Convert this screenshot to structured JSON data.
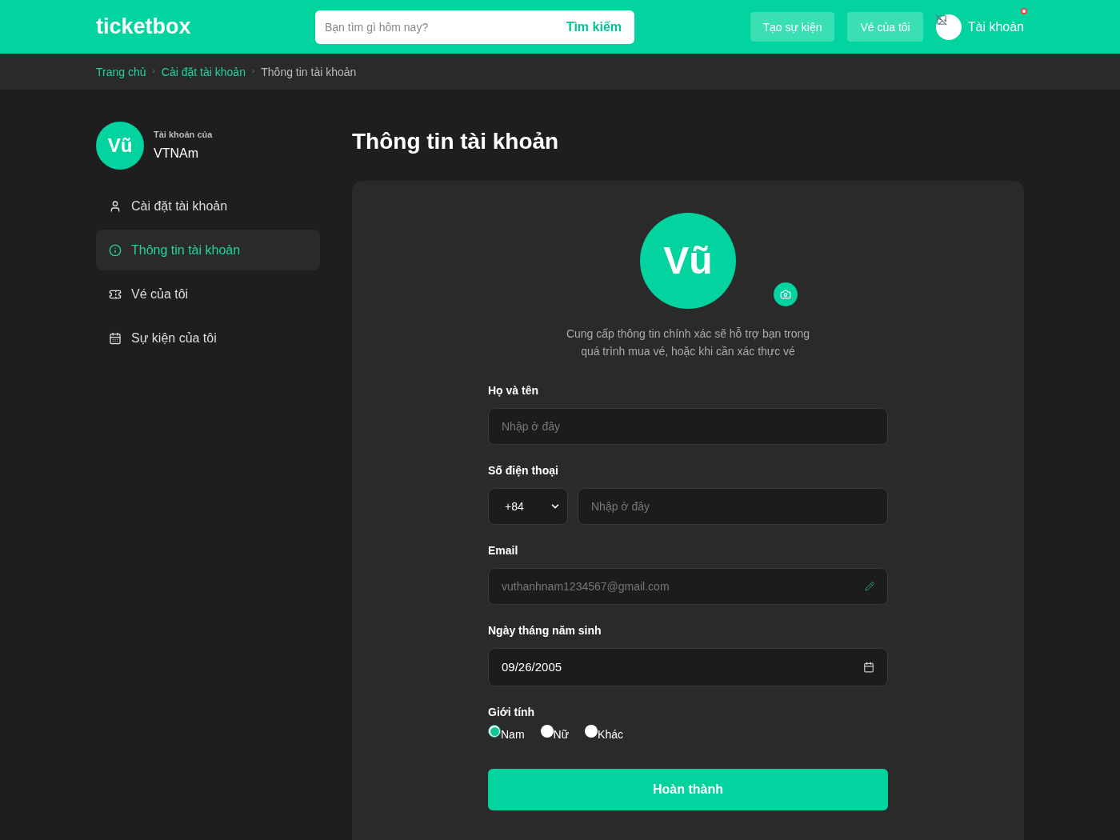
{
  "header": {
    "logo": "ticketbox",
    "search": {
      "placeholder": "Bạn tìm gì hôm nay?",
      "button": "Tìm kiếm"
    },
    "buttons": [
      "Tạo sự kiện",
      "Vé của tôi"
    ],
    "account": "Tài khoản",
    "notification": true
  },
  "breadcrumb_separator": "›",
  "breadcrumb": [
    {
      "label": "Trang chủ",
      "current": false
    },
    {
      "label": "Cài đặt tài khoản",
      "current": false
    },
    {
      "label": "Thông tin tài khoản",
      "current": true
    }
  ],
  "sidebar": {
    "avatar": "Vũ",
    "caption": "Tài khoản của",
    "username": "VTNAm",
    "items": [
      {
        "label": "Cài đặt tài khoản",
        "kind": "user",
        "selected": false
      },
      {
        "label": "Thông tin tài khoản",
        "kind": "info",
        "selected": true
      },
      {
        "label": "Vé của tôi",
        "kind": "ticket",
        "selected": false
      },
      {
        "label": "Sự kiện của tôi",
        "kind": "calendar",
        "selected": false
      }
    ]
  },
  "page": {
    "title": "Thông tin tài khoản",
    "avatar": "Vũ",
    "description": "Cung cấp thông tin chính xác sẽ hỗ trợ bạn trong quá trình mua vé, hoặc khi cần xác thực vé"
  },
  "form": {
    "name": {
      "label": "Họ và tên",
      "placeholder": "Nhập ở đây"
    },
    "phone": {
      "label": "Số điện thoại",
      "code": "+84",
      "placeholder": "Nhập ở đây"
    },
    "email": {
      "label": "Email",
      "value": "vuthanhnam1234567@gmail.com"
    },
    "birthday": {
      "label": "Ngày tháng năm sinh",
      "value": "09/26/2005"
    },
    "gender": {
      "label": "Giới tính",
      "options": [
        {
          "label": "Nam",
          "selected": true
        },
        {
          "label": "Nữ",
          "selected": false
        },
        {
          "label": "Khác",
          "selected": false
        }
      ]
    },
    "submit": "Hoàn thành"
  }
}
